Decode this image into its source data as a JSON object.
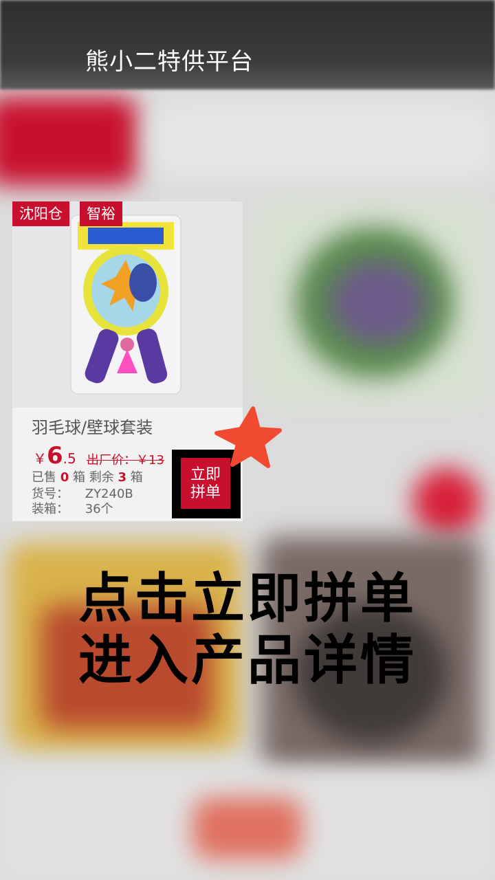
{
  "app": {
    "title": "熊小二特供平台"
  },
  "card": {
    "tags": [
      "沈阳仓",
      "智裕"
    ],
    "name": "羽毛球/壁球套装",
    "price_symbol": "￥",
    "price_int": "6",
    "price_dec": ".5",
    "original_price": "出厂价：￥13",
    "sold_label": "已售",
    "sold_count": "0",
    "unit": "箱",
    "remaining_label": "剩余",
    "remaining_count": "3",
    "item_no_label": "货号：",
    "item_no": "ZY240B",
    "pack_label": "装箱：",
    "pack_value": "36个",
    "buy_line1": "立即",
    "buy_line2": "拼单"
  },
  "overlay": {
    "line1": "点击立即拼单",
    "line2": "进入产品详情"
  },
  "colors": {
    "accent": "#c8102e",
    "star": "#f04a30"
  }
}
